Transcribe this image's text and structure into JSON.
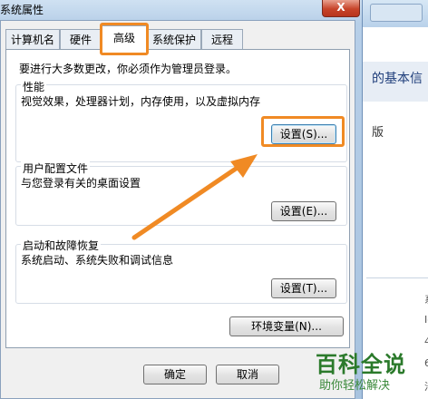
{
  "dialog": {
    "title": "系统属性",
    "close_glyph": "X"
  },
  "tabs": [
    {
      "label": "计算机名"
    },
    {
      "label": "硬件"
    },
    {
      "label": "高级"
    },
    {
      "label": "系统保护"
    },
    {
      "label": "远程"
    }
  ],
  "panel": {
    "admin_notice": "要进行大多数更改，你必须作为管理员登录。",
    "performance": {
      "title": "性能",
      "desc": "视觉效果，处理器计划，内存使用，以及虚拟内存",
      "button": "设置(S)..."
    },
    "user_profiles": {
      "title": "用户配置文件",
      "desc": "与您登录有关的桌面设置",
      "button": "设置(E)..."
    },
    "startup_recovery": {
      "title": "启动和故障恢复",
      "desc": "系统启动、系统失败和调试信息",
      "button": "设置(T)..."
    },
    "env_button": "环境变量(N)..."
  },
  "footer": {
    "ok": "确定",
    "cancel": "取消"
  },
  "background_window": {
    "title_fragment": "的基本信",
    "text_fragment": "版",
    "side_fragments": [
      "系",
      "Ic",
      "4",
      "6",
      "沿"
    ]
  },
  "watermark": {
    "title": "百科全说",
    "subtitle": "助你轻松解决"
  },
  "colors": {
    "annotation_orange": "#f08a24",
    "window_frame_blue": "#b7cfe8",
    "close_red": "#c7442a",
    "watermark_green": "#2b7a2b"
  }
}
